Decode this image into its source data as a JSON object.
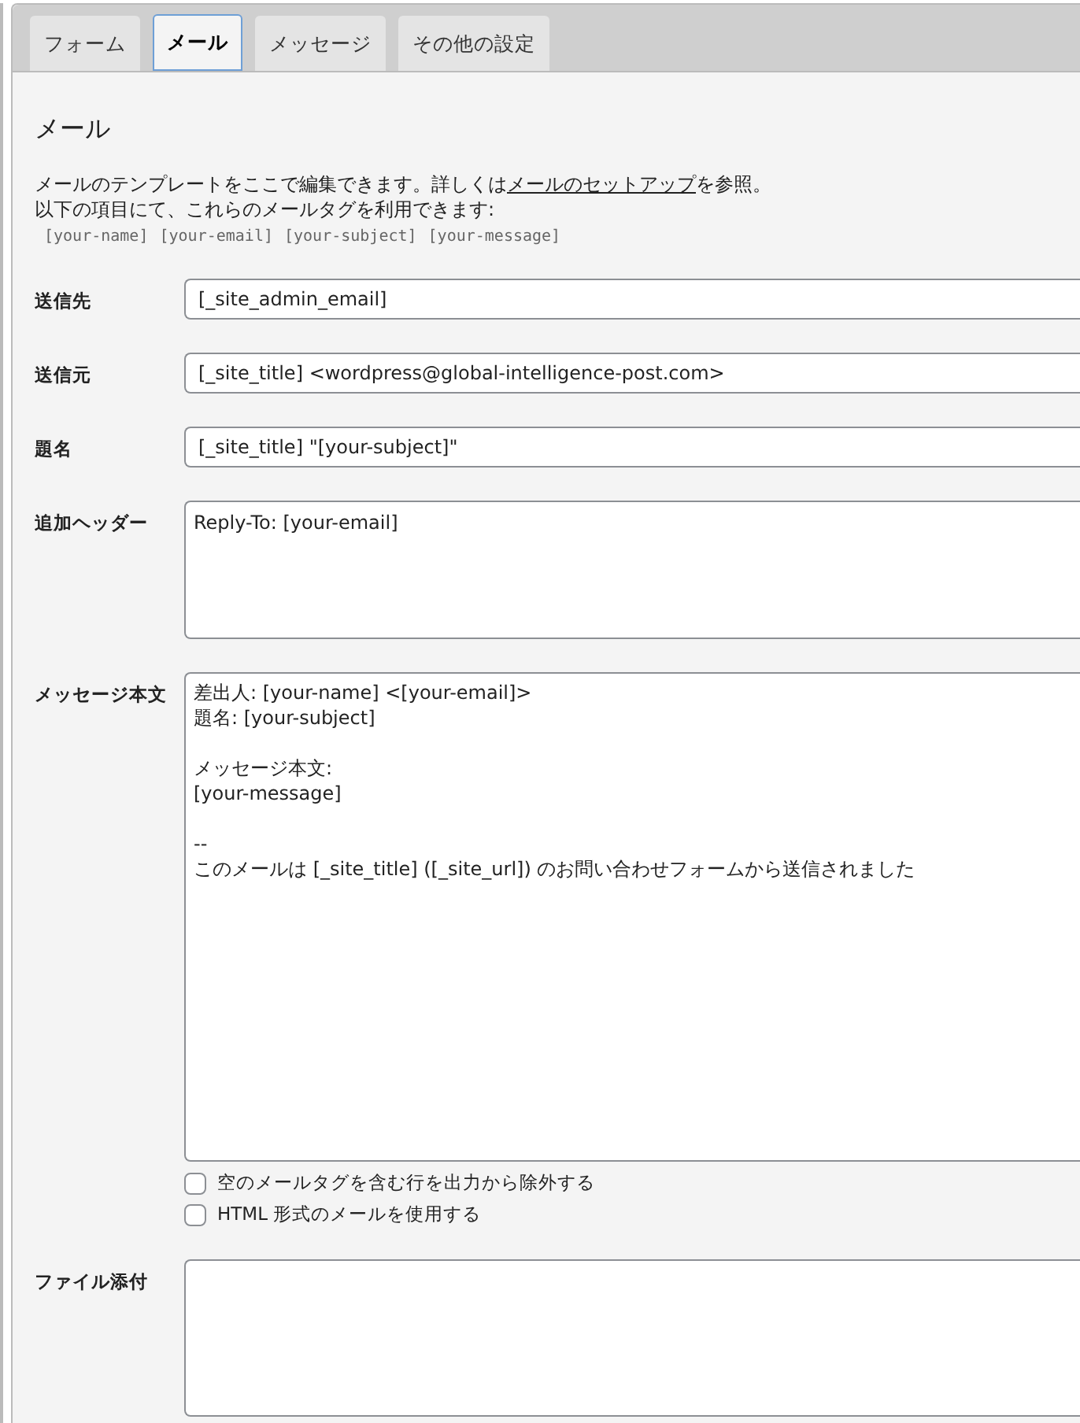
{
  "tabs": [
    {
      "label": "フォーム",
      "selected": false
    },
    {
      "label": "メール",
      "selected": true
    },
    {
      "label": "メッセージ",
      "selected": false
    },
    {
      "label": "その他の設定",
      "selected": false
    }
  ],
  "heading": "メール",
  "description": {
    "before": "メールのテンプレートをここで編集できます。詳しくは",
    "link": "メールのセットアップ",
    "after": "を参照。"
  },
  "tags_note": "以下の項目にて、これらのメールタグを利用できます:",
  "mail_tags": [
    "[your-name]",
    "[your-email]",
    "[your-subject]",
    "[your-message]"
  ],
  "fields": [
    {
      "label": "送信先",
      "kind": "input",
      "value": "[_site_admin_email]"
    },
    {
      "label": "送信元",
      "kind": "input",
      "value": "[_site_title] <wordpress@global-intelligence-post.com>"
    },
    {
      "label": "題名",
      "kind": "input",
      "value": "[_site_title] \"[your-subject]\""
    },
    {
      "label": "追加ヘッダー",
      "kind": "textarea",
      "value": "Reply-To: [your-email]"
    },
    {
      "label": "メッセージ本文",
      "kind": "body",
      "value": "差出人: [your-name] <[your-email]>\n題名: [your-subject]\n\nメッセージ本文:\n[your-message]\n\n-- \nこのメールは [_site_title] ([_site_url]) のお問い合わせフォームから送信されました",
      "options": [
        {
          "label": "空のメールタグを含む行を出力から除外する",
          "checked": false
        },
        {
          "label": "HTML 形式のメールを使用する",
          "checked": false
        }
      ]
    },
    {
      "label": "ファイル添付",
      "kind": "attach"
    }
  ]
}
